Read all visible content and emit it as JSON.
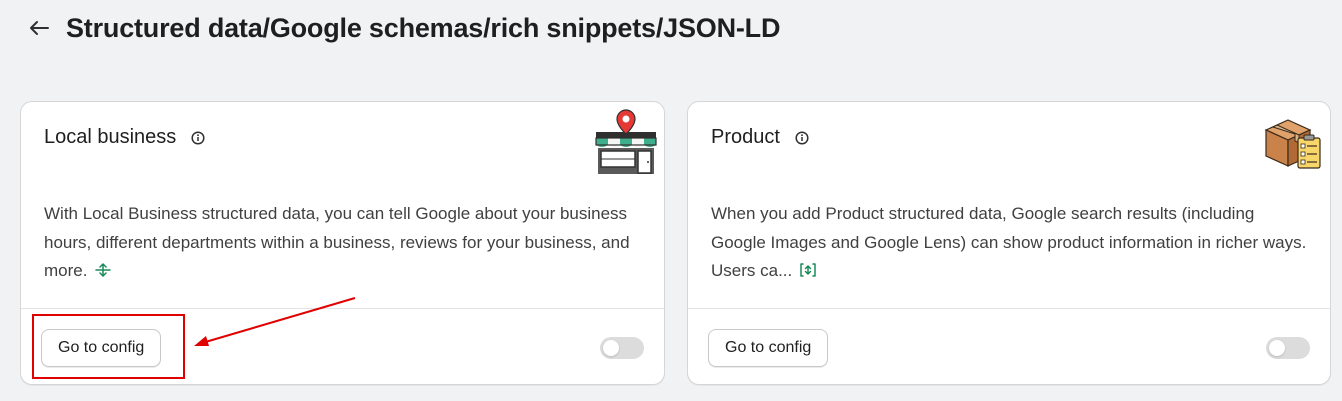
{
  "header": {
    "title": "Structured data/Google schemas/rich snippets/JSON-LD",
    "back_icon": "arrow-left-icon"
  },
  "cards": [
    {
      "title": "Local business",
      "info_icon": "info-icon",
      "illustration": "storefront-icon",
      "description": "With Local Business structured data, you can tell Google about your business hours, different departments within a business, reviews for your business, and more.",
      "expand_icon": "collapse-icon",
      "button_label": "Go to config",
      "enabled": false
    },
    {
      "title": "Product",
      "info_icon": "info-icon",
      "illustration": "product-box-icon",
      "description": "When you add Product structured data, Google search results (including Google Images and Google Lens) can show product information in richer ways. Users ca...",
      "expand_icon": "expand-icon",
      "button_label": "Go to config",
      "enabled": false
    }
  ],
  "annotation": {
    "color": "#e00000"
  }
}
